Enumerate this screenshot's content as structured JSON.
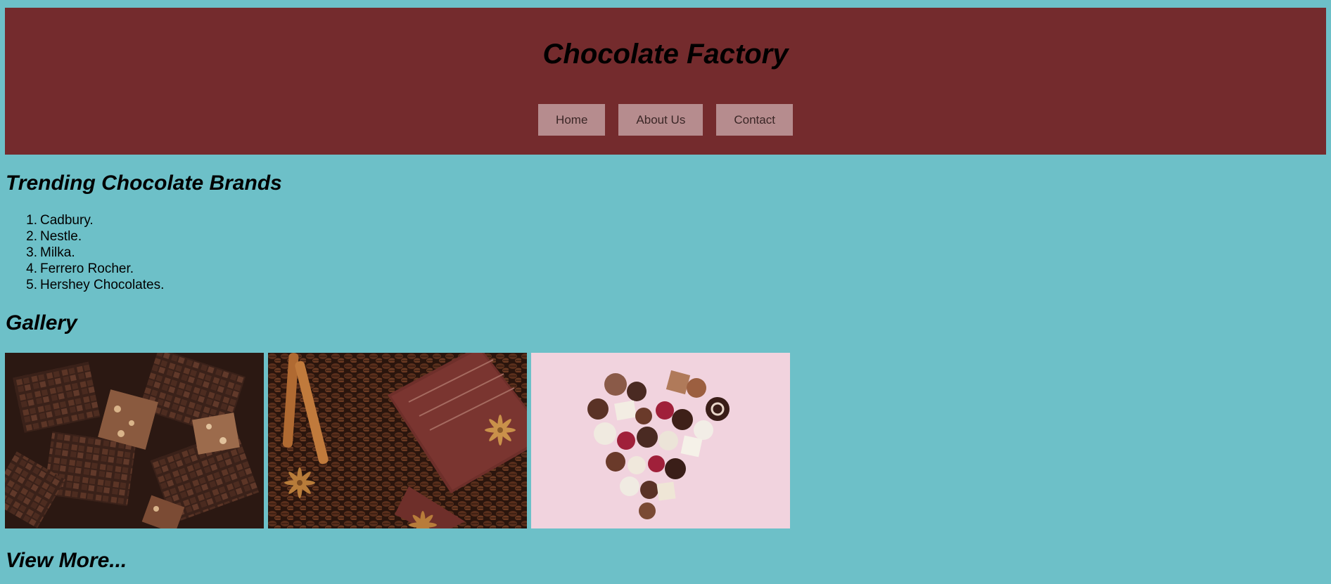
{
  "header": {
    "title": "Chocolate Factory",
    "nav": [
      {
        "label": "Home"
      },
      {
        "label": "About Us"
      },
      {
        "label": "Contact"
      }
    ]
  },
  "brands": {
    "heading": "Trending Chocolate Brands",
    "items": [
      {
        "number": "1.",
        "label": "Cadbury."
      },
      {
        "number": "2.",
        "label": "Nestle."
      },
      {
        "number": "3.",
        "label": "Milka."
      },
      {
        "number": "4.",
        "label": "Ferrero Rocher."
      },
      {
        "number": "5.",
        "label": "Hershey Chocolates."
      }
    ]
  },
  "gallery": {
    "heading": "Gallery",
    "images": [
      {
        "subject": "chocolate pieces"
      },
      {
        "subject": "chocolate bar with coffee beans and cinnamon"
      },
      {
        "subject": "heart of assorted chocolates"
      }
    ],
    "view_more": "View More..."
  },
  "colors": {
    "page_background": "#6dc0c8",
    "header_background": "#742b2d",
    "nav_button_background": "#b68c8e"
  }
}
